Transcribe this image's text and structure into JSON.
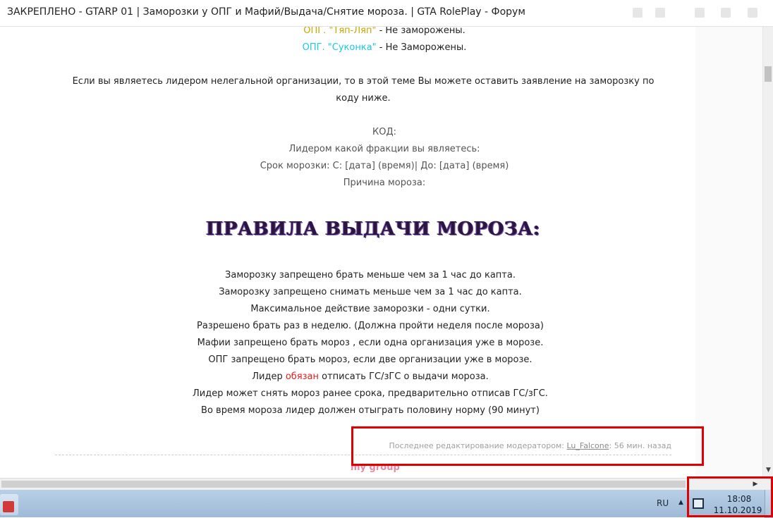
{
  "window": {
    "title": "ЗАКРЕПЛЕНО - GTARP 01 | Заморозки у ОПГ и Мафий/Выдача/Снятие мороза. | GTA RolePlay - Форум"
  },
  "orgs": [
    {
      "name": "ОПГ. \"Тяп-Ляп\"",
      "status": " - Не заморожены.",
      "color": "#c7a700"
    },
    {
      "name": "ОПГ. \"Суконка\"",
      "status": " - Не Заморожены.",
      "color": "#19c9e8"
    }
  ],
  "intro": {
    "line1": "Если вы являетесь лидером нелегальной организации, то в этой теме Вы можете оставить заявление на заморозку по",
    "line2": "коду ниже."
  },
  "code_form": {
    "header": "КОД:",
    "q1": "Лидером какой фракции вы являетесь:",
    "q2": "Срок морозки: С: [дата] (время)| До: [дата] (время)",
    "q3": "Причина мороза:"
  },
  "rules": {
    "heading": "ПРАВИЛА ВЫДАЧИ МОРОЗА:",
    "items": [
      "Заморозку запрещено брать меньше чем за 1 час до капта.",
      "Заморозку запрещено снимать меньше чем за 1 час до капта.",
      "Максимальное действие заморозки - одни сутки.",
      "Разрешено брать раз в неделю. (Должна пройти неделя после мороза)",
      "Мафии запрещено брать мороз , если одна организация уже в морозе.",
      "ОПГ запрещено брать мороз, если две организации уже в морозе."
    ],
    "leader_rule": {
      "prefix": "Лидер ",
      "highlight": "обязан",
      "suffix": " отписать ГС/зГС о выдачи мороза."
    },
    "items_tail": [
      "Лидер может снять мороз ранее срока, предварительно отписав ГС/зГС.",
      "Во время мороза лидер должен отыграть половину норму (90 минут)"
    ]
  },
  "edit_note": {
    "prefix": "Последнее редактирование модератором: ",
    "user": "Lu_Falcone",
    "suffix": ": 56 мин. назад"
  },
  "footer_tag": "my group",
  "taskbar": {
    "lang": "RU",
    "time": "18:08",
    "date": "11.10.2019"
  },
  "colors": {
    "highlight_red": "#e02020",
    "annotation_red": "#e00000",
    "heading": "#2a1640"
  }
}
